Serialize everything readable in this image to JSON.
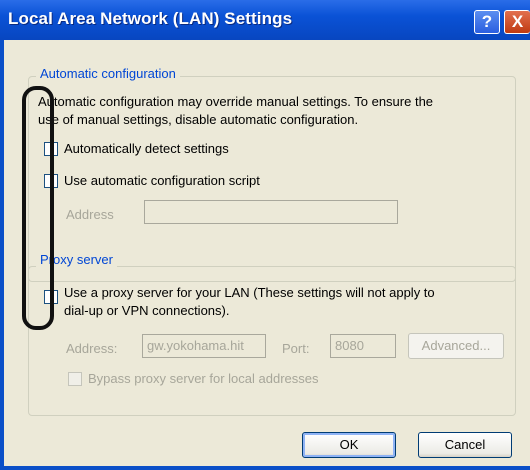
{
  "window": {
    "title": "Local Area Network (LAN) Settings",
    "help_label": "?",
    "close_label": "X"
  },
  "auto_config": {
    "legend": "Automatic configuration",
    "description_line1": "Automatic configuration may override manual settings.  To ensure the",
    "description_line2": "use of manual settings, disable automatic configuration.",
    "detect_label": "Automatically detect settings",
    "detect_checked": false,
    "script_label": "Use automatic configuration script",
    "script_checked": false,
    "address_label": "Address",
    "address_value": ""
  },
  "proxy": {
    "legend": "Proxy server",
    "use_proxy_line1": "Use a proxy server for your LAN (These settings will not apply to",
    "use_proxy_line2": "dial-up or VPN connections).",
    "use_proxy_checked": false,
    "address_label": "Address:",
    "address_value": "gw.yokohama.hit",
    "port_label": "Port:",
    "port_value": "8080",
    "advanced_label": "Advanced...",
    "bypass_label": "Bypass proxy server for local addresses",
    "bypass_checked": false
  },
  "buttons": {
    "ok_label": "OK",
    "cancel_label": "Cancel"
  },
  "colors": {
    "titlebar": "#0a52d6",
    "dialog_bg": "#ece9d8",
    "group_label": "#0046d5",
    "disabled_text": "#a7a69a"
  }
}
